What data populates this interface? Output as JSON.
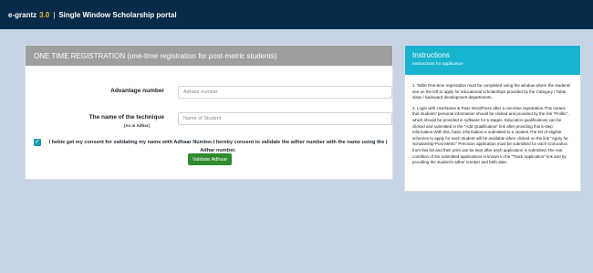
{
  "header": {
    "brand": "e-grantz",
    "version": "3.0",
    "separator": "|",
    "portal": "Single Window Scholarship portal"
  },
  "registration": {
    "title": "ONE TIME REGISTRATION (one-time registration for post-metric students)",
    "fields": [
      {
        "label": "Advantage number",
        "sublabel": "",
        "placeholder": "Adhaar number",
        "value": ""
      },
      {
        "label": "The name of the technique",
        "sublabel": "(As in Adhar)",
        "placeholder": "Name of Student",
        "value": ""
      }
    ],
    "consent": {
      "checked": true,
      "check_glyph": "✓",
      "text": "I hebie get my consent for validating my name with Adhaar Number.I hereby consent to validate the adher number with the name using the | Adhar number."
    },
    "validate_label": "Validate Adhaar"
  },
  "instructions": {
    "title": "Instructions",
    "subtitle": "Instructions for applicance",
    "paragraphs": [
      "1. Table One-time registration must be completed using the window where the students see on the left to apply for educational scholarships provided by the Category / Table class / backward development departments.",
      "2. Login with UserName & Pass WordPress after a one-time registration.This means that students' personal information should be clicked and provided by the link \"Profile\", which should be provided in software for 5 stages. Education qualifications can be clicked and submitted in the \"Add Qualification\" link after providing this 5-step information.With this, basic information is submitted to a student.The list of eligible schemes to apply for each student will be available when clicked on the link \"Apply for Scholarship-Post Metric\" Precision application must be submitted for each scolorahsn from this list and their print can be kept after each application is submitted.The real condition of the submitted applications is known in the \"Track Application\" link and by providing the student's adher number and birth date."
    ]
  },
  "colors": {
    "topbar": "#062a49",
    "version_accent": "#f3b62a",
    "reg_header": "#9e9e9e",
    "instr_header": "#17b3cf",
    "validate_button": "#2e8b2e",
    "background": "#c5d3e3"
  }
}
